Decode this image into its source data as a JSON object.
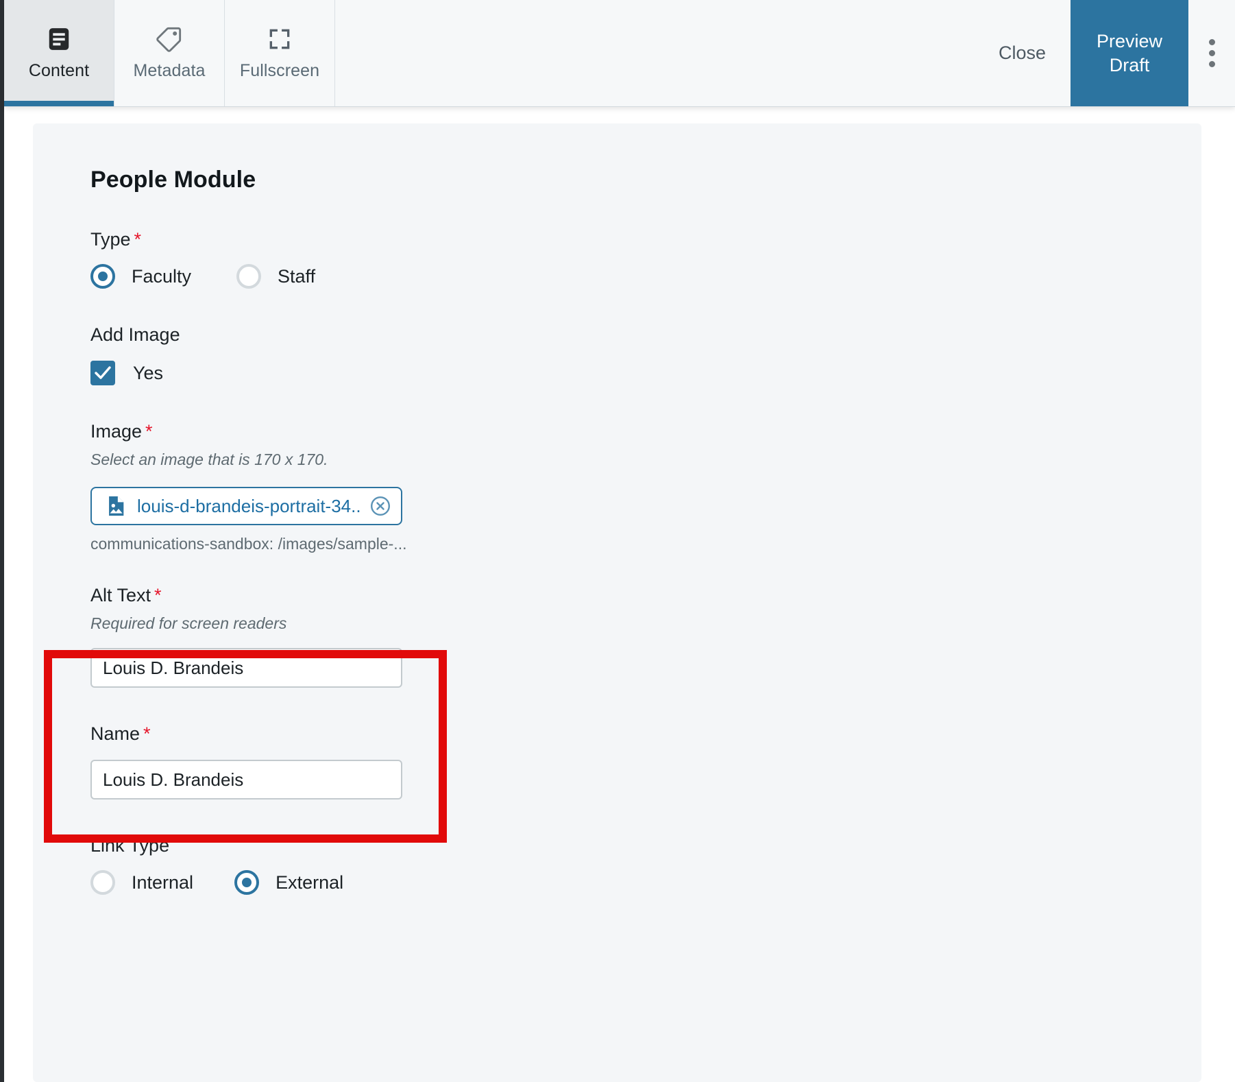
{
  "toolbar": {
    "tabs": [
      {
        "label": "Content",
        "icon": "document-lines-icon",
        "active": true
      },
      {
        "label": "Metadata",
        "icon": "tag-icon",
        "active": false
      },
      {
        "label": "Fullscreen",
        "icon": "expand-icon",
        "active": false
      }
    ],
    "close_label": "Close",
    "preview_label": "Preview Draft",
    "more_icon": "kebab-menu-icon",
    "accent_color": "#2c74a0"
  },
  "form": {
    "title": "People Module",
    "required_marker": "*",
    "type_field": {
      "label": "Type",
      "required": true,
      "options": [
        {
          "label": "Faculty",
          "selected": true
        },
        {
          "label": "Staff",
          "selected": false
        }
      ]
    },
    "add_image_field": {
      "label": "Add Image",
      "checkbox_label": "Yes",
      "checked": true
    },
    "image_field": {
      "label": "Image",
      "required": true,
      "help": "Select an image that is 170 x 170.",
      "chip_icon": "image-file-icon",
      "chip_name": "louis-d-brandeis-portrait-34...",
      "clear_icon": "close-circle-icon",
      "path": "communications-sandbox: /images/sample-..."
    },
    "alt_text_field": {
      "label": "Alt Text",
      "required": true,
      "help": "Required for screen readers",
      "value": "Louis D. Brandeis",
      "highlight_color": "#e10a0a"
    },
    "name_field": {
      "label": "Name",
      "required": true,
      "value": "Louis D. Brandeis"
    },
    "link_type_field": {
      "label": "Link Type",
      "options": [
        {
          "label": "Internal",
          "selected": false
        },
        {
          "label": "External",
          "selected": true
        }
      ]
    }
  }
}
